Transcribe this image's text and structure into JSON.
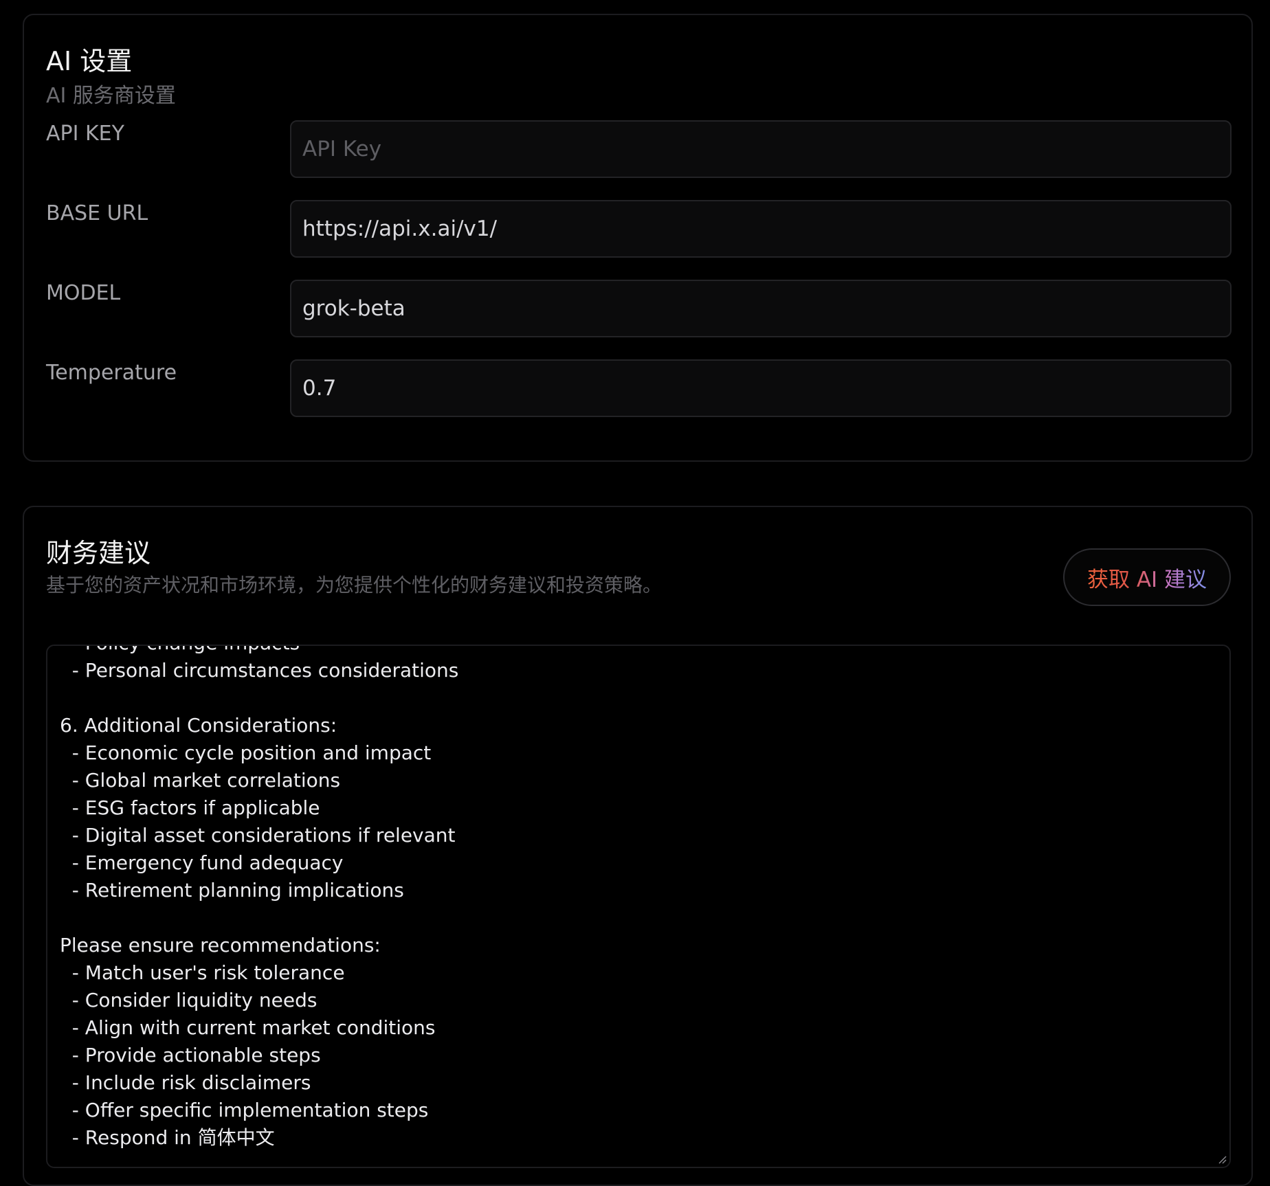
{
  "ai_settings": {
    "title": "AI 设置",
    "subtitle": "AI 服务商设置",
    "fields": [
      {
        "label": "API KEY",
        "value": "",
        "placeholder": "API Key"
      },
      {
        "label": "BASE URL",
        "value": "https://api.x.ai/v1/",
        "placeholder": ""
      },
      {
        "label": "MODEL",
        "value": "grok-beta",
        "placeholder": ""
      },
      {
        "label": "Temperature",
        "value": "0.7",
        "placeholder": ""
      }
    ]
  },
  "financial_advice": {
    "title": "财务建议",
    "subtitle": "基于您的资产状况和市场环境，为您提供个性化的财务建议和投资策略。",
    "button_label": "获取 AI 建议",
    "lines": [
      "  - Policy change impacts",
      "  - Personal circumstances considerations",
      "",
      "6. Additional Considerations:",
      "  - Economic cycle position and impact",
      "  - Global market correlations",
      "  - ESG factors if applicable",
      "  - Digital asset considerations if relevant",
      "  - Emergency fund adequacy",
      "  - Retirement planning implications",
      "",
      "Please ensure recommendations:",
      "  - Match user's risk tolerance",
      "  - Consider liquidity needs",
      "  - Align with current market conditions",
      "  - Provide actionable steps",
      "  - Include risk disclaimers",
      "  - Offer specific implementation steps",
      "  - Respond in 简体中文"
    ]
  },
  "colors": {
    "background": "#000000",
    "input_background": "#0b0b0c",
    "border": "#1c1c1f",
    "button_gradient": [
      "#f0643c",
      "#c178c9",
      "#7f8fe6"
    ]
  }
}
